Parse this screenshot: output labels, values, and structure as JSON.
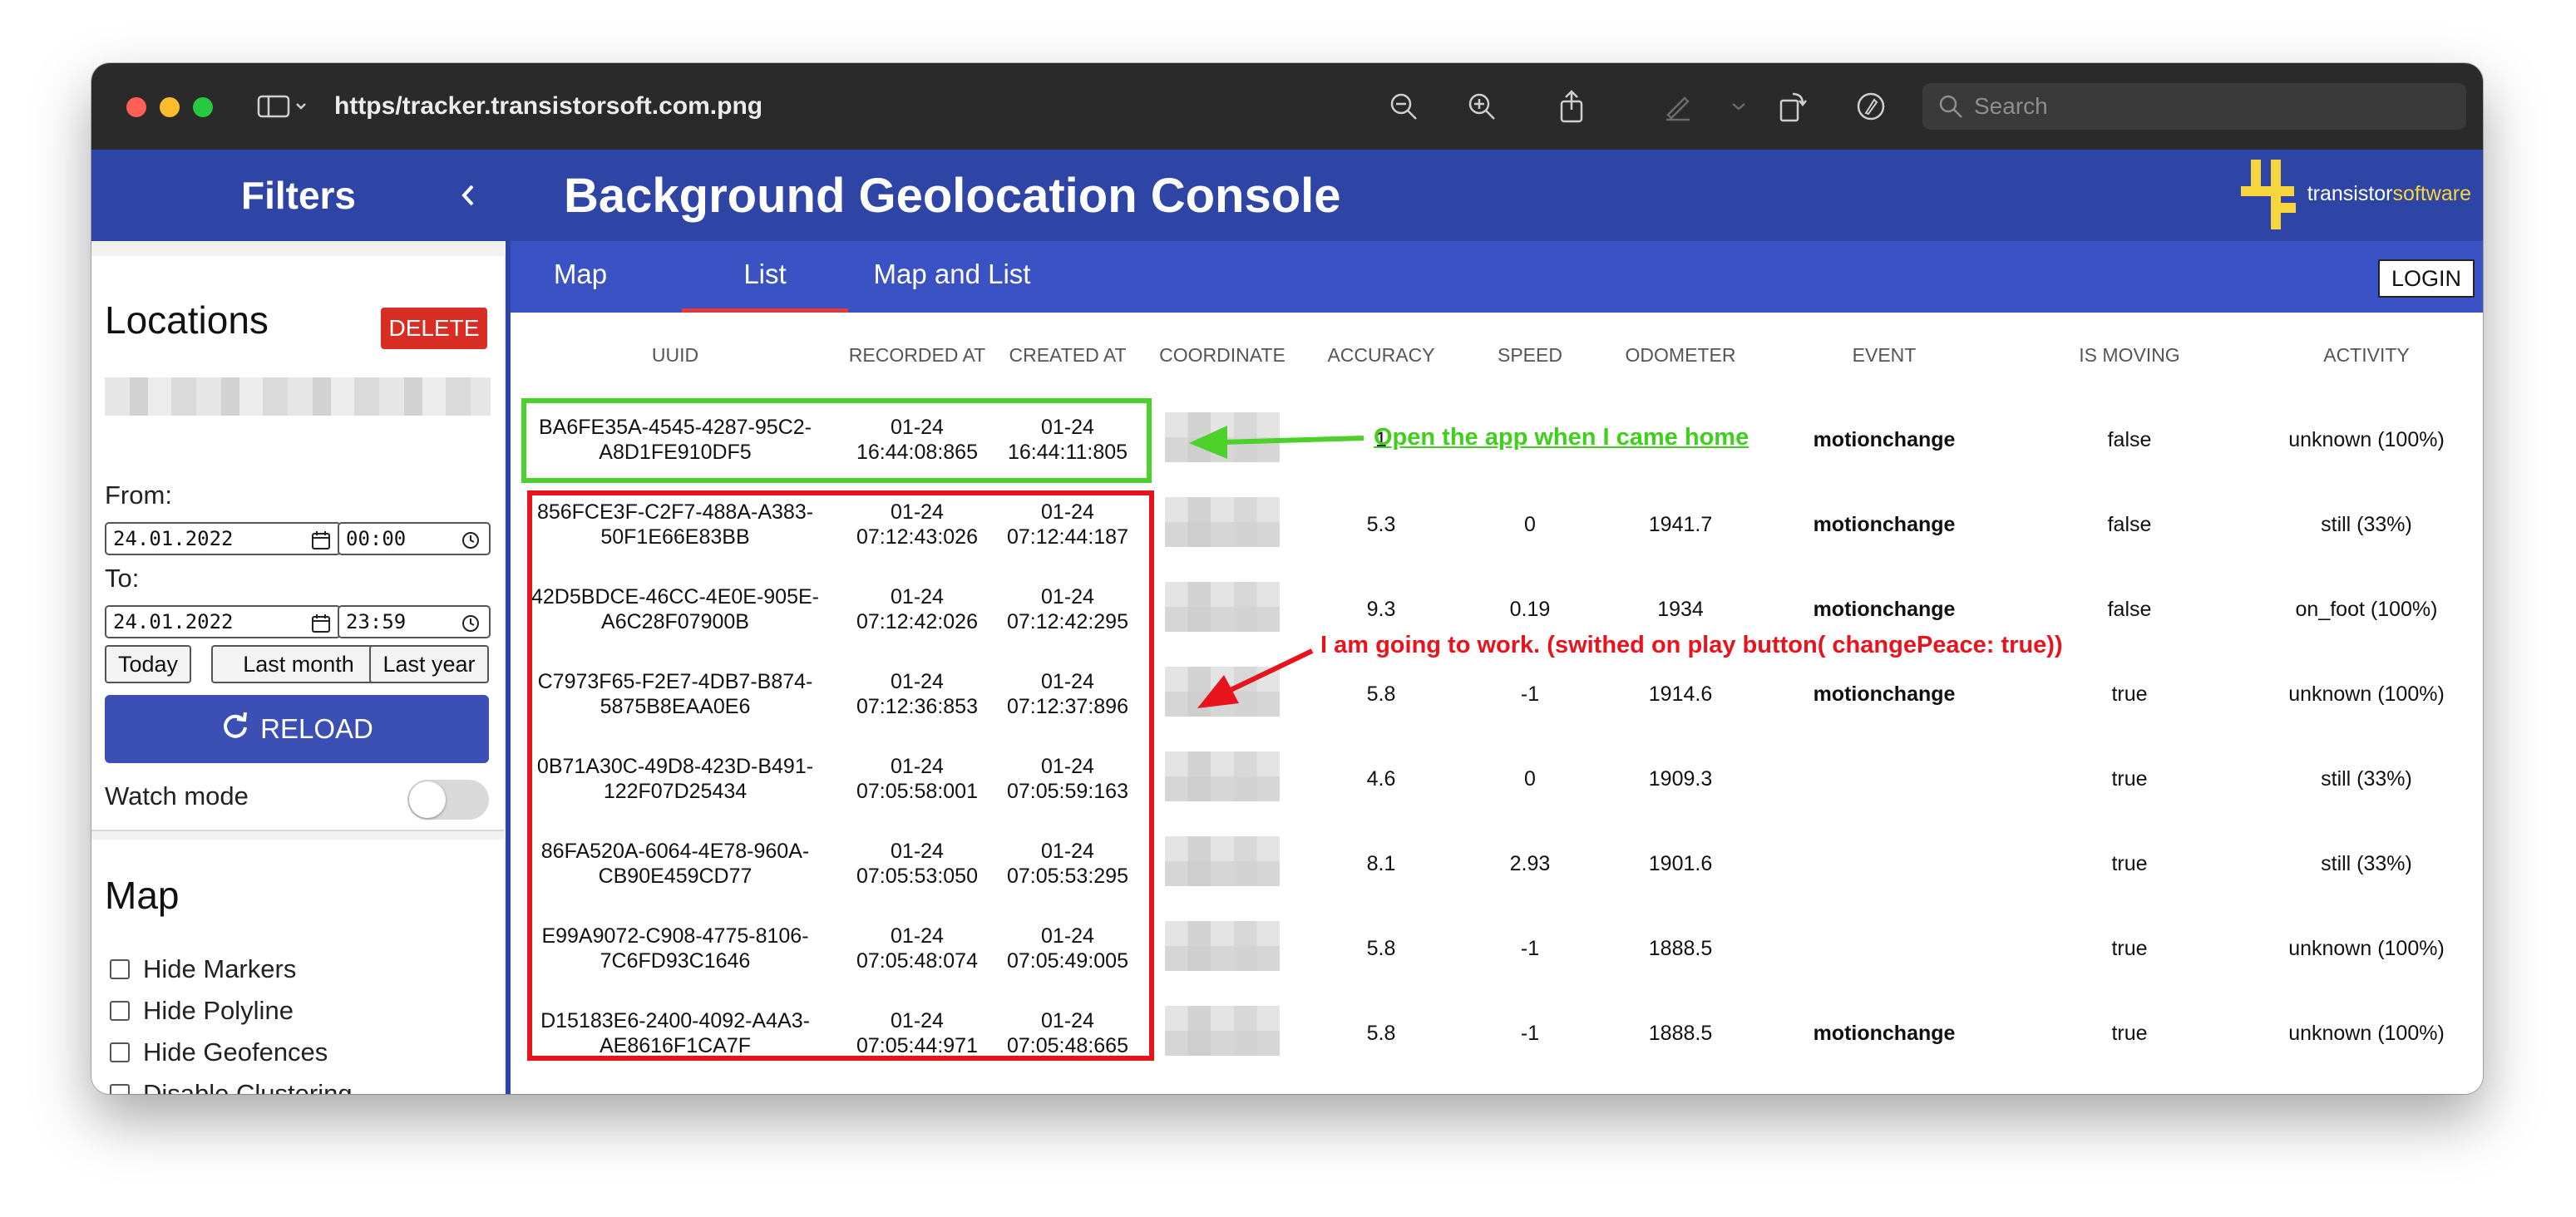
{
  "window": {
    "url": "https/tracker.transistorsoft.com.png",
    "search_placeholder": "Search"
  },
  "sidebar": {
    "header": "Filters",
    "locations_title": "Locations",
    "delete_label": "DELETE",
    "from_label": "From:",
    "to_label": "To:",
    "from_date": "24.01.2022",
    "from_time": "00:00",
    "to_date": "24.01.2022",
    "to_time": "23:59",
    "quick": [
      "Today",
      "Last month",
      "Last year"
    ],
    "reload_label": "RELOAD",
    "watch_mode_label": "Watch mode",
    "watch_mode_on": false,
    "map_title": "Map",
    "map_options": [
      "Hide Markers",
      "Hide Polyline",
      "Hide Geofences",
      "Disable Clustering"
    ]
  },
  "app": {
    "title": "Background Geolocation Console",
    "logo_text_a": "transistor",
    "logo_text_b": "software",
    "tabs": [
      "Map",
      "List",
      "Map and List"
    ],
    "active_tab": "List",
    "login_label": "LOGIN"
  },
  "table": {
    "headers": [
      "UUID",
      "RECORDED AT",
      "CREATED AT",
      "COORDINATE",
      "ACCURACY",
      "SPEED",
      "ODOMETER",
      "EVENT",
      "IS MOVING",
      "ACTIVITY"
    ],
    "rows": [
      {
        "uuid": [
          "BA6FE35A-4545-4287-95C2-",
          "A8D1FE910DF5"
        ],
        "recorded": [
          "01-24",
          "16:44:08:865"
        ],
        "created": [
          "01-24",
          "16:44:11:805"
        ],
        "accuracy": "1",
        "speed": "",
        "odometer": "",
        "event": "motionchange",
        "moving": "false",
        "activity": "unknown (100%)"
      },
      {
        "uuid": [
          "856FCE3F-C2F7-488A-A383-",
          "50F1E66E83BB"
        ],
        "recorded": [
          "01-24",
          "07:12:43:026"
        ],
        "created": [
          "01-24",
          "07:12:44:187"
        ],
        "accuracy": "5.3",
        "speed": "0",
        "odometer": "1941.7",
        "event": "motionchange",
        "moving": "false",
        "activity": "still (33%)"
      },
      {
        "uuid": [
          "42D5BDCE-46CC-4E0E-905E-",
          "A6C28F07900B"
        ],
        "recorded": [
          "01-24",
          "07:12:42:026"
        ],
        "created": [
          "01-24",
          "07:12:42:295"
        ],
        "accuracy": "9.3",
        "speed": "0.19",
        "odometer": "1934",
        "event": "motionchange",
        "moving": "false",
        "activity": "on_foot (100%)"
      },
      {
        "uuid": [
          "C7973F65-F2E7-4DB7-B874-",
          "5875B8EAA0E6"
        ],
        "recorded": [
          "01-24",
          "07:12:36:853"
        ],
        "created": [
          "01-24",
          "07:12:37:896"
        ],
        "accuracy": "5.8",
        "speed": "-1",
        "odometer": "1914.6",
        "event": "motionchange",
        "moving": "true",
        "activity": "unknown (100%)"
      },
      {
        "uuid": [
          "0B71A30C-49D8-423D-B491-",
          "122F07D25434"
        ],
        "recorded": [
          "01-24",
          "07:05:58:001"
        ],
        "created": [
          "01-24",
          "07:05:59:163"
        ],
        "accuracy": "4.6",
        "speed": "0",
        "odometer": "1909.3",
        "event": "",
        "moving": "true",
        "activity": "still (33%)"
      },
      {
        "uuid": [
          "86FA520A-6064-4E78-960A-",
          "CB90E459CD77"
        ],
        "recorded": [
          "01-24",
          "07:05:53:050"
        ],
        "created": [
          "01-24",
          "07:05:53:295"
        ],
        "accuracy": "8.1",
        "speed": "2.93",
        "odometer": "1901.6",
        "event": "",
        "moving": "true",
        "activity": "still (33%)"
      },
      {
        "uuid": [
          "E99A9072-C908-4775-8106-",
          "7C6FD93C1646"
        ],
        "recorded": [
          "01-24",
          "07:05:48:074"
        ],
        "created": [
          "01-24",
          "07:05:49:005"
        ],
        "accuracy": "5.8",
        "speed": "-1",
        "odometer": "1888.5",
        "event": "",
        "moving": "true",
        "activity": "unknown (100%)"
      },
      {
        "uuid": [
          "D15183E6-2400-4092-A4A3-",
          "AE8616F1CA7F"
        ],
        "recorded": [
          "01-24",
          "07:05:44:971"
        ],
        "created": [
          "01-24",
          "07:05:48:665"
        ],
        "accuracy": "5.8",
        "speed": "-1",
        "odometer": "1888.5",
        "event": "motionchange",
        "moving": "true",
        "activity": "unknown (100%)"
      }
    ]
  },
  "annotations": {
    "green": "Open the app when I came home",
    "red": "I am going to work. (swithed on play button( changePeace: true))",
    "green_color": "#4bd12a",
    "red_color": "#e8141d"
  },
  "colors": {
    "header_blue": "#2f45a6",
    "tab_blue": "#3b52c4",
    "delete_red": "#d82d24",
    "reload_blue": "#3c4fb4",
    "tab_underline": "#e03a3a",
    "logo_yellow": "#f6d63c"
  }
}
